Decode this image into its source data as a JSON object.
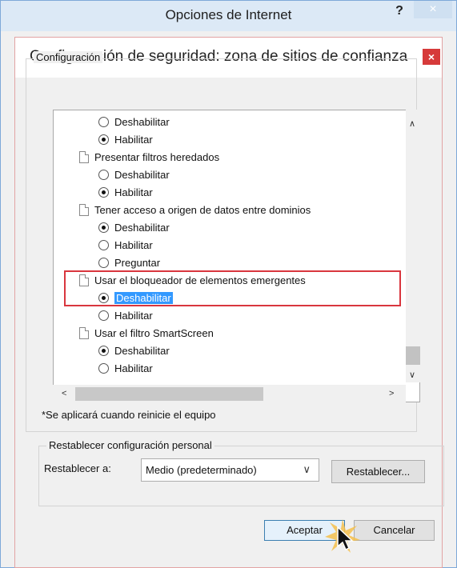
{
  "outer_window": {
    "title": "Opciones de Internet",
    "help_label": "?",
    "close_label": "×"
  },
  "dialog": {
    "title": "Configuración de seguridad: zona de sitios de confianza",
    "close_label": "×",
    "config_group_label": "Configuración",
    "list_rows": [
      {
        "kind": "radio",
        "checked": false,
        "label": "Deshabilitar",
        "selected": false
      },
      {
        "kind": "radio",
        "checked": true,
        "label": "Habilitar",
        "selected": false
      },
      {
        "kind": "item",
        "label": "Presentar filtros heredados"
      },
      {
        "kind": "radio",
        "checked": false,
        "label": "Deshabilitar",
        "selected": false
      },
      {
        "kind": "radio",
        "checked": true,
        "label": "Habilitar",
        "selected": false
      },
      {
        "kind": "item",
        "label": "Tener acceso a origen de datos entre dominios"
      },
      {
        "kind": "radio",
        "checked": true,
        "label": "Deshabilitar",
        "selected": false
      },
      {
        "kind": "radio",
        "checked": false,
        "label": "Habilitar",
        "selected": false
      },
      {
        "kind": "radio",
        "checked": false,
        "label": "Preguntar",
        "selected": false
      },
      {
        "kind": "item",
        "label": "Usar el bloqueador de elementos emergentes"
      },
      {
        "kind": "radio",
        "checked": true,
        "label": "Deshabilitar",
        "selected": true
      },
      {
        "kind": "radio",
        "checked": false,
        "label": "Habilitar",
        "selected": false
      },
      {
        "kind": "item",
        "label": "Usar el filtro SmartScreen"
      },
      {
        "kind": "radio",
        "checked": true,
        "label": "Deshabilitar",
        "selected": false
      },
      {
        "kind": "radio",
        "checked": false,
        "label": "Habilitar",
        "selected": false
      }
    ],
    "restart_note": "*Se aplicará cuando reinicie el equipo",
    "reset_group_label": "Restablecer configuración personal",
    "reset_to_label": "Restablecer a:",
    "reset_select_value": "Medio (predeterminado)",
    "reset_button": "Restablecer...",
    "ok_button": "Aceptar",
    "cancel_button": "Cancelar"
  },
  "colors": {
    "highlight_box": "#d9363e",
    "selection": "#3399ff"
  }
}
